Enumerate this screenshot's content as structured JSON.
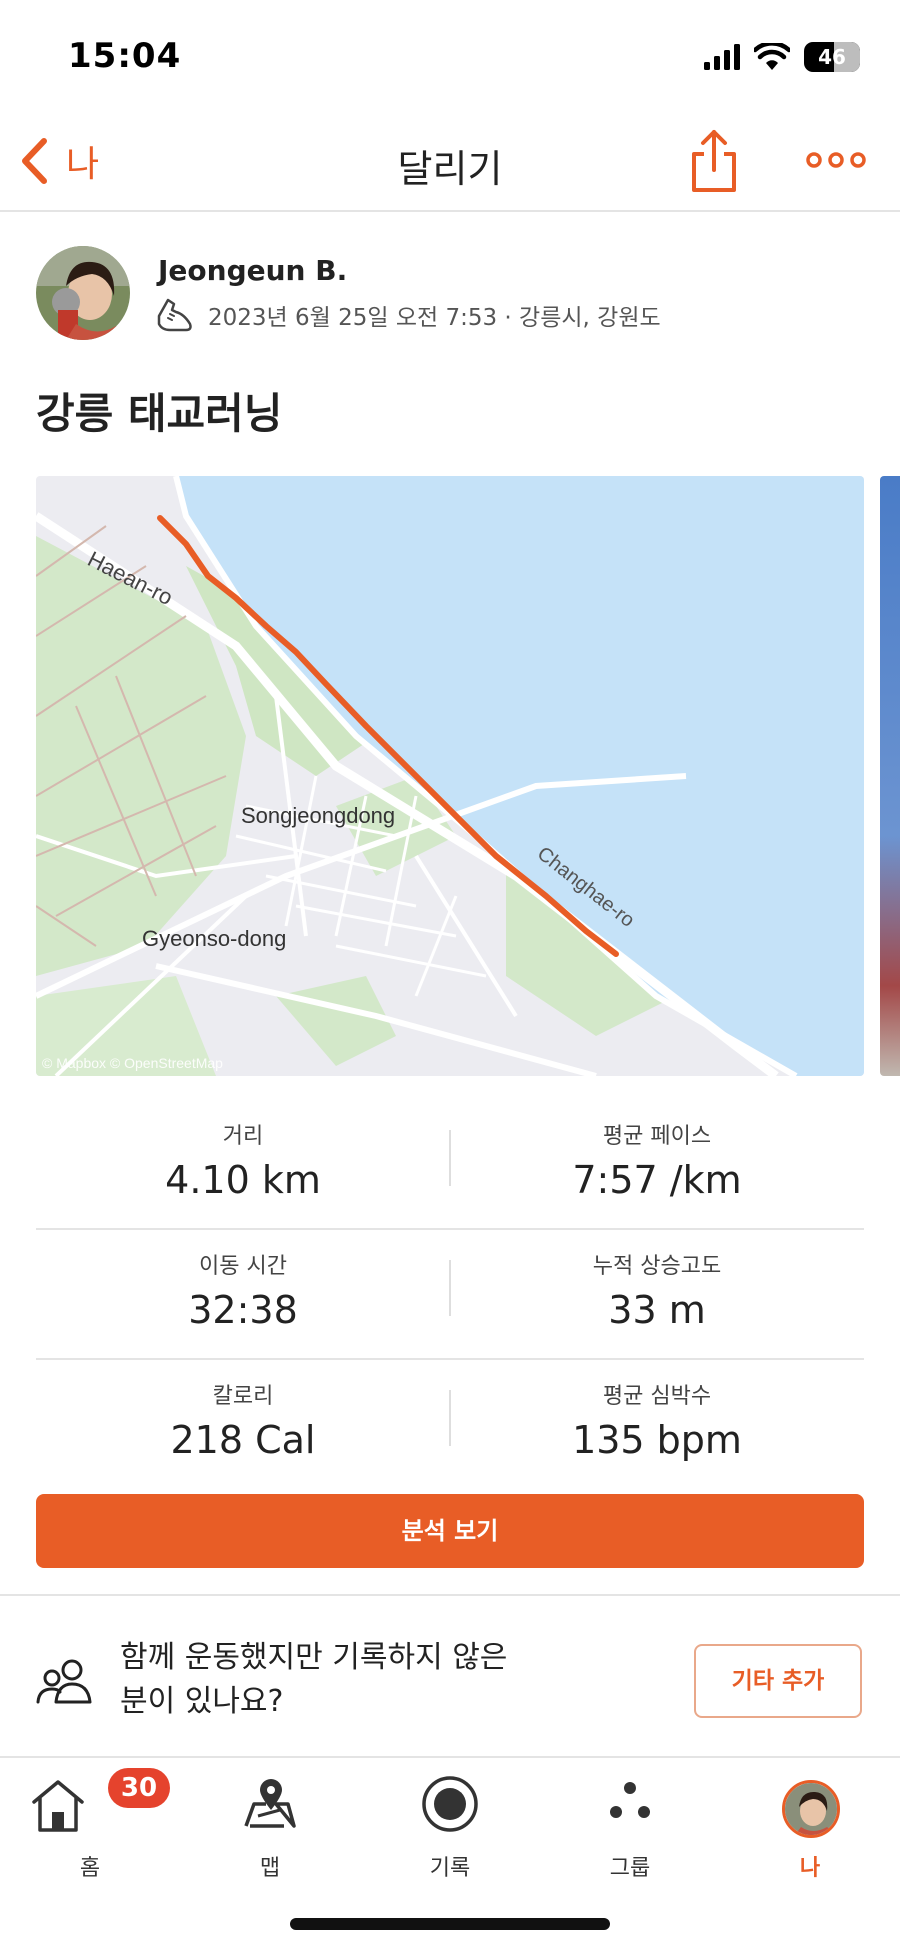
{
  "status_bar": {
    "time": "15:04",
    "battery": "46"
  },
  "nav": {
    "back_label": "나",
    "title": "달리기"
  },
  "activity": {
    "athlete_name": "Jeongeun B.",
    "meta": "2023년 6월 25일 오전 7:53 · 강릉시, 강원도",
    "title": "강릉 태교러닝"
  },
  "map": {
    "labels": {
      "road_1": "Haean-ro",
      "district_1": "Songjeongdong",
      "district_2": "Gyeonso-dong",
      "road_2": "Changhae-ro",
      "attribution": "© Mapbox © OpenStreetMap"
    },
    "route_color": "#e85d26",
    "water_color": "#c5e2f8"
  },
  "stats": [
    {
      "label": "거리",
      "value": "4.10 km"
    },
    {
      "label": "평균 페이스",
      "value": "7:57 /km"
    },
    {
      "label": "이동 시간",
      "value": "32:38"
    },
    {
      "label": "누적 상승고도",
      "value": "33 m"
    },
    {
      "label": "칼로리",
      "value": "218 Cal"
    },
    {
      "label": "평균 심박수",
      "value": "135 bpm"
    }
  ],
  "analysis_button": "분석 보기",
  "together": {
    "line1": "함께 운동했지만 기록하지 않은",
    "line2": "분이 있나요?",
    "add_button": "기타 추가"
  },
  "tabs": [
    {
      "label": "홈",
      "icon": "home-icon",
      "badge": "30"
    },
    {
      "label": "맵",
      "icon": "map-icon"
    },
    {
      "label": "기록",
      "icon": "record-icon"
    },
    {
      "label": "그룹",
      "icon": "groups-icon"
    },
    {
      "label": "나",
      "icon": "profile-avatar",
      "active": true
    }
  ],
  "colors": {
    "accent": "#e85d26",
    "badge": "#e5432d",
    "text": "#222222"
  }
}
